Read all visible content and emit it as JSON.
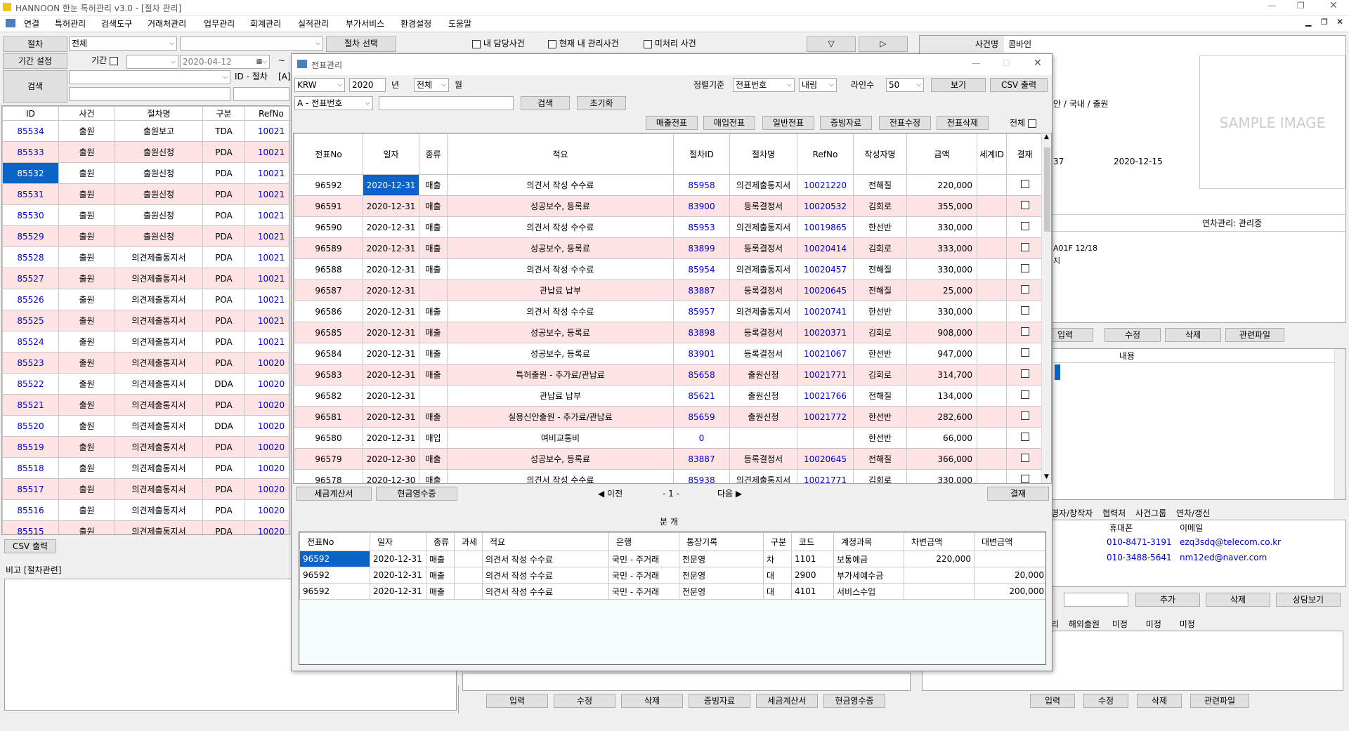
{
  "title": "HANNOON 한눈 특허관리 v3.0 - [절차 관리]",
  "menu": [
    "연결",
    "특허관리",
    "검색도구",
    "거래처관리",
    "업무관리",
    "회계관리",
    "실적관리",
    "부가서비스",
    "환경설정",
    "도움말"
  ],
  "filter": {
    "procedure_label": "절차",
    "procedure_value": "전체",
    "select_btn": "절차 선택",
    "my_case": "내 담당사건",
    "current_case": "현재 내 관리사건",
    "unprocessed": "미처리 사건",
    "down_arrow": "▽",
    "play": "▷",
    "period_label": "기간 설정",
    "period_chk_label": "기간",
    "date_from": "2020-04-12",
    "tilde": "~",
    "search_label": "검색",
    "id_label": "ID - 절차",
    "a_label": "[A]"
  },
  "left_table": {
    "headers": [
      "ID",
      "사건",
      "절차명",
      "구분",
      "RefNo"
    ],
    "rows": [
      [
        "85534",
        "출원",
        "출원보고",
        "TDA",
        "10021"
      ],
      [
        "85533",
        "출원",
        "출원신청",
        "PDA",
        "10021"
      ],
      [
        "85532",
        "출원",
        "출원신청",
        "PDA",
        "10021"
      ],
      [
        "85531",
        "출원",
        "출원신청",
        "PDA",
        "10021"
      ],
      [
        "85530",
        "출원",
        "출원신청",
        "POA",
        "10021"
      ],
      [
        "85529",
        "출원",
        "출원신청",
        "PDA",
        "10021"
      ],
      [
        "85528",
        "출원",
        "의견제출통지서",
        "PDA",
        "10021"
      ],
      [
        "85527",
        "출원",
        "의견제출통지서",
        "PDA",
        "10021"
      ],
      [
        "85526",
        "출원",
        "의견제출통지서",
        "POA",
        "10021"
      ],
      [
        "85525",
        "출원",
        "의견제출통지서",
        "PDA",
        "10021"
      ],
      [
        "85524",
        "출원",
        "의견제출통지서",
        "PDA",
        "10021"
      ],
      [
        "85523",
        "출원",
        "의견제출통지서",
        "PDA",
        "10020"
      ],
      [
        "85522",
        "출원",
        "의견제출통지서",
        "DDA",
        "10020"
      ],
      [
        "85521",
        "출원",
        "의견제출통지서",
        "PDA",
        "10020"
      ],
      [
        "85520",
        "출원",
        "의견제출통지서",
        "DDA",
        "10020"
      ],
      [
        "85519",
        "출원",
        "의견제출통지서",
        "PDA",
        "10020"
      ],
      [
        "85518",
        "출원",
        "의견제출통지서",
        "PDA",
        "10020"
      ],
      [
        "85517",
        "출원",
        "의견제출통지서",
        "PDA",
        "10020"
      ],
      [
        "85516",
        "출원",
        "의견제출통지서",
        "PDA",
        "10020"
      ],
      [
        "85515",
        "출원",
        "의견제출통지서",
        "PDA",
        "10020"
      ]
    ]
  },
  "left_csv": "CSV 출력",
  "memo_label": "비고 [절차관련]",
  "right": {
    "case_name_label": "사건명",
    "case_name_value": "콤바인",
    "row2": "안 / 국내 / 출원",
    "num_37": "37",
    "date": "2020-12-15",
    "annual": "연차관리: 관리중",
    "memo1": "A01F 12/18",
    "memo2": "지",
    "sample": "SAMPLE IMAGE",
    "btn_in": "입력",
    "btn_edit": "수정",
    "btn_del": "삭제",
    "btn_file": "관련파일",
    "content_label": "내용",
    "tabs": [
      "명자/창작자",
      "협력처",
      "사건그룹",
      "연차/갱신"
    ],
    "contact_headers": [
      "휴대폰",
      "이메일"
    ],
    "contacts": [
      [
        "010-8471-3191",
        "ezq3sdq@telecom.co.kr"
      ],
      [
        "010-3488-5641",
        "nm12ed@naver.com"
      ]
    ],
    "btn_add": "추가",
    "btn_del2": "삭제",
    "btn_consult": "상담보기",
    "tabs2": [
      "리",
      "해외출원",
      "미정",
      "미정",
      "미정"
    ]
  },
  "bottom_btns": [
    "입력",
    "수정",
    "삭제",
    "증빙자료",
    "세금계산서",
    "현금영수증"
  ],
  "bottom_right_btns": [
    "입력",
    "수정",
    "삭제",
    "관련파일"
  ],
  "dialog": {
    "title": "전표관리",
    "currency": "KRW",
    "year": "2020",
    "year_unit": "년",
    "month": "전체",
    "month_unit": "월",
    "sort_label": "정렬기준",
    "sort_value": "전표번호",
    "order_value": "내림",
    "lines_label": "라인수",
    "lines_value": "50",
    "view_btn": "보기",
    "csv_btn": "CSV 출력",
    "search_field": "A - 전표번호",
    "search_btn": "검색",
    "reset_btn": "초기화",
    "action_btns": [
      "매출전표",
      "매입전표",
      "일반전표",
      "증빙자료",
      "전표수정",
      "전표삭제"
    ],
    "all_label": "전체",
    "headers": [
      "전표No",
      "일자",
      "종류",
      "적요",
      "절차ID",
      "절차명",
      "RefNo",
      "작성자명",
      "금액",
      "세계ID",
      "결재"
    ],
    "rows": [
      [
        "96592",
        "2020-12-31",
        "매출",
        "의견서 작성 수수료",
        "85958",
        "의견제출통지서",
        "10021220",
        "전해질",
        "220,000"
      ],
      [
        "96591",
        "2020-12-31",
        "매출",
        "성공보수, 등록료",
        "83900",
        "등록결정서",
        "10020532",
        "김회로",
        "355,000"
      ],
      [
        "96590",
        "2020-12-31",
        "매출",
        "의견서 작성 수수료",
        "85953",
        "의견제출통지서",
        "10019865",
        "한선반",
        "330,000"
      ],
      [
        "96589",
        "2020-12-31",
        "매출",
        "성공보수, 등록료",
        "83899",
        "등록결정서",
        "10020414",
        "김회로",
        "333,000"
      ],
      [
        "96588",
        "2020-12-31",
        "매출",
        "의견서 작성 수수료",
        "85954",
        "의견제출통지서",
        "10020457",
        "전해질",
        "330,000"
      ],
      [
        "96587",
        "2020-12-31",
        "",
        "관납료 납부",
        "83887",
        "등록결정서",
        "10020645",
        "전해질",
        "25,000"
      ],
      [
        "96586",
        "2020-12-31",
        "매출",
        "의견서 작성 수수료",
        "85957",
        "의견제출통지서",
        "10020741",
        "한선반",
        "330,000"
      ],
      [
        "96585",
        "2020-12-31",
        "매출",
        "성공보수, 등록료",
        "83898",
        "등록결정서",
        "10020371",
        "김회로",
        "908,000"
      ],
      [
        "96584",
        "2020-12-31",
        "매출",
        "성공보수, 등록료",
        "83901",
        "등록결정서",
        "10021067",
        "한선반",
        "947,000"
      ],
      [
        "96583",
        "2020-12-31",
        "매출",
        "특허출원 - 추가료/관납료",
        "85658",
        "출원신청",
        "10021771",
        "김회로",
        "314,700"
      ],
      [
        "96582",
        "2020-12-31",
        "",
        "관납료 납부",
        "85621",
        "출원신청",
        "10021766",
        "전해질",
        "134,000"
      ],
      [
        "96581",
        "2020-12-31",
        "매출",
        "실용신안출원 - 추가료/관납료",
        "85659",
        "출원신청",
        "10021772",
        "한선반",
        "282,600"
      ],
      [
        "96580",
        "2020-12-31",
        "매입",
        "여비교통비",
        "0",
        "",
        "",
        "한선반",
        "66,000"
      ],
      [
        "96579",
        "2020-12-30",
        "매출",
        "성공보수, 등록료",
        "83887",
        "등록결정서",
        "10020645",
        "전해질",
        "366,000"
      ],
      [
        "96578",
        "2020-12-30",
        "매출",
        "의견서 작성 수수료",
        "85938",
        "의견제출통지서",
        "10021771",
        "김회로",
        "330,000"
      ]
    ],
    "tax_btn": "세금계산서",
    "cash_btn": "현금영수증",
    "prev": "◀ 이전",
    "page": "- 1 -",
    "next": "다음 ▶",
    "approve_btn": "결재",
    "split_label": "분 개",
    "split_headers": [
      "전표No",
      "일자",
      "종류",
      "과세",
      "적요",
      "은행",
      "통장기록",
      "구분",
      "코드",
      "계정과목",
      "차변금액",
      "대변금액"
    ],
    "split_rows": [
      [
        "96592",
        "2020-12-31",
        "매출",
        "",
        "의견서 작성 수수료",
        "국민 - 주거래",
        "전문영",
        "차",
        "1101",
        "보통예금",
        "220,000",
        ""
      ],
      [
        "96592",
        "2020-12-31",
        "매출",
        "",
        "의견서 작성 수수료",
        "국민 - 주거래",
        "전문영",
        "대",
        "2900",
        "부가세예수금",
        "",
        "20,000"
      ],
      [
        "96592",
        "2020-12-31",
        "매출",
        "",
        "의견서 작성 수수료",
        "국민 - 주거래",
        "전문영",
        "대",
        "4101",
        "서비스수입",
        "",
        "200,000"
      ]
    ]
  },
  "colors": {
    "pink": "#fde3e3",
    "link": "#0000c8",
    "select": "#0a64c8"
  }
}
